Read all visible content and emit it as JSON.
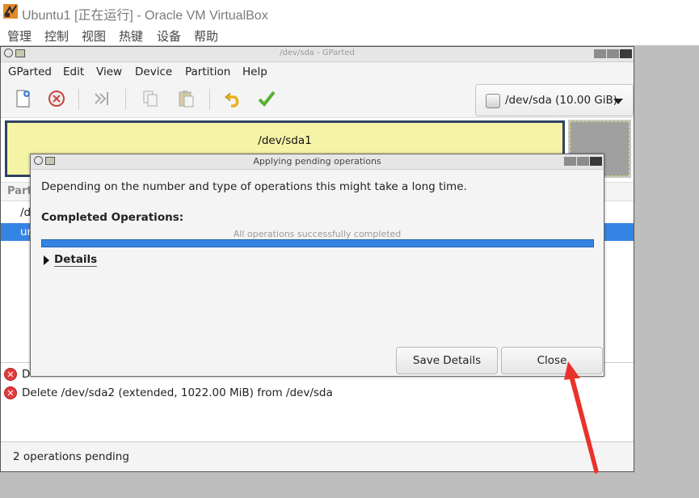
{
  "host": {
    "title": "Ubuntu1 [正在运行] - Oracle VM VirtualBox",
    "menu": [
      "管理",
      "控制",
      "视图",
      "热键",
      "设备",
      "帮助"
    ]
  },
  "gparted": {
    "title": "/dev/sda - GParted",
    "menu": [
      "GParted",
      "Edit",
      "View",
      "Device",
      "Partition",
      "Help"
    ],
    "toolbar_icons": [
      "new-partition-icon",
      "delete-icon",
      "resize-move-icon",
      "copy-icon",
      "paste-icon",
      "undo-icon",
      "apply-icon"
    ],
    "device_selector": "/dev/sda (10.00 GiB)",
    "disk_map": {
      "partition_name": "/dev/sda1"
    },
    "list_header": "Part",
    "rows": [
      "/d",
      "ur"
    ],
    "operations": [
      "D",
      "Delete /dev/sda2 (extended, 1022.00 MiB) from /dev/sda"
    ],
    "status": "2 operations pending"
  },
  "dialog": {
    "title": "Applying pending operations",
    "message": "Depending on the number and type of operations this might take a long time.",
    "completed_heading": "Completed Operations:",
    "progress_text": "All operations successfully completed",
    "progress_fraction": 1.0,
    "details_label": "Details",
    "save_details_button": "Save Details",
    "close_button": "Close"
  },
  "colors": {
    "selection": "#3584e4",
    "partition_fill": "#f5f3a5",
    "partition_border": "#2f4163",
    "annotation_arrow": "#e8322b"
  }
}
